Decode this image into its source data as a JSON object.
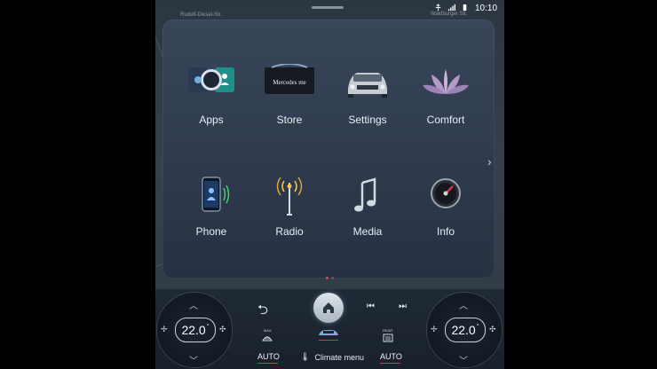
{
  "status_bar": {
    "street_left": "Rudolf-Diesel-Str.",
    "street_right": "Waldburger Str.",
    "time": "10:10",
    "icons": [
      "usb-icon",
      "signal-icon",
      "battery-icon"
    ]
  },
  "apps": [
    {
      "label": "Apps",
      "icon": "apps-icon"
    },
    {
      "label": "Store",
      "icon": "store-icon",
      "icon_text": "Mercedes me"
    },
    {
      "label": "Settings",
      "icon": "car-settings-icon"
    },
    {
      "label": "Comfort",
      "icon": "lotus-icon"
    },
    {
      "label": "Phone",
      "icon": "phone-icon"
    },
    {
      "label": "Radio",
      "icon": "radio-tower-icon"
    },
    {
      "label": "Media",
      "icon": "music-note-icon"
    },
    {
      "label": "Info",
      "icon": "gauge-icon"
    }
  ],
  "pagination": {
    "pages": 2,
    "current": 1
  },
  "climate": {
    "left_temp": "22.0",
    "right_temp": "22.0",
    "unit": "°",
    "max_label": "MAX",
    "rear_label": "REAR",
    "auto_left": "AUTO",
    "auto_right": "AUTO",
    "menu_label": "Climate menu"
  },
  "colors": {
    "accent_red": "#e0304a",
    "panel_bg": "#33404f"
  }
}
